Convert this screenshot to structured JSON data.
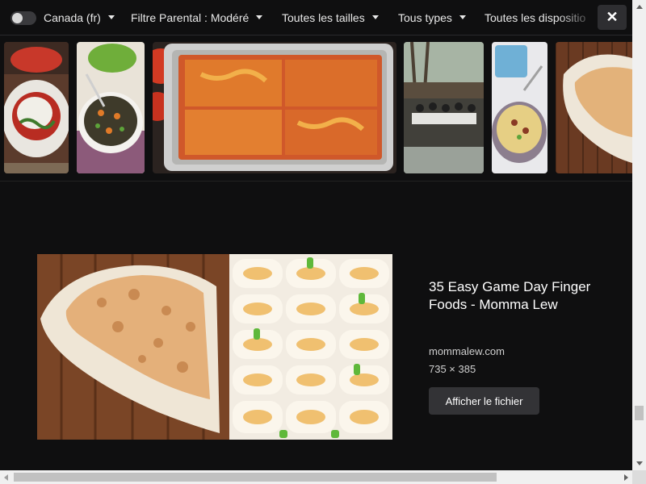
{
  "filters": {
    "safe_toggle_on": false,
    "region": "Canada (fr)",
    "safe_search": "Filtre Parental : Modéré",
    "size": "Toutes les tailles",
    "type": "Tous types",
    "layout": "Toutes les dispositio"
  },
  "close_icon": "close-icon",
  "thumbnails": [
    {
      "subject": "stuffed-pepper-dish",
      "active": false
    },
    {
      "subject": "vegetable-salad-bowl",
      "active": false
    },
    {
      "subject": "lasagna-pan",
      "active": false
    },
    {
      "subject": "outdoor-party-tables",
      "active": false
    },
    {
      "subject": "potato-soup-bowl",
      "active": false
    },
    {
      "subject": "tortilla-pinwheels",
      "active": true
    }
  ],
  "detail": {
    "title": "35 Easy Game Day Finger Foods - Momma Lew",
    "source": "mommalew.com",
    "dimensions": "735 × 385",
    "open_file_label": "Afficher le fichier"
  }
}
